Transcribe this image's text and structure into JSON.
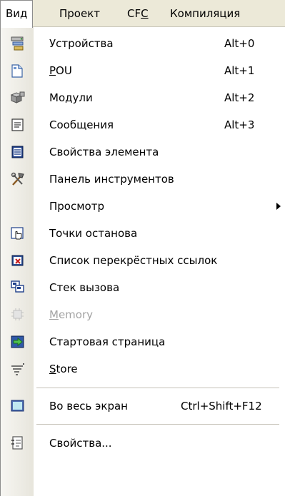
{
  "menubar": {
    "items": [
      {
        "label": "Вид"
      },
      {
        "label": "Проект"
      },
      {
        "label_prefix": "CF",
        "label_mnemonic": "C"
      },
      {
        "label": "Компиляция"
      }
    ]
  },
  "menu": {
    "items": [
      {
        "label": "Устройства",
        "shortcut": "Alt+0",
        "icon": "devices-icon"
      },
      {
        "label_mnemonic": "P",
        "label_rest": "OU",
        "shortcut": "Alt+1",
        "icon": "pou-icon"
      },
      {
        "label": "Модули",
        "shortcut": "Alt+2",
        "icon": "modules-icon"
      },
      {
        "label": "Сообщения",
        "shortcut": "Alt+3",
        "icon": "messages-icon"
      },
      {
        "label": "Свойства элемента",
        "icon": "element-properties-icon"
      },
      {
        "label": "Панель инструментов",
        "icon": "tools-icon"
      },
      {
        "label": "Просмотр",
        "submenu": true
      },
      {
        "label": "Точки останова",
        "icon": "breakpoints-icon"
      },
      {
        "label": "Список перекрёстных ссылок",
        "icon": "cross-references-icon"
      },
      {
        "label": "Стек вызова",
        "icon": "call-stack-icon"
      },
      {
        "label_mnemonic": "M",
        "label_rest": "emory",
        "disabled": true,
        "icon": "memory-icon"
      },
      {
        "label": "Стартовая страница",
        "icon": "start-page-icon"
      },
      {
        "label_mnemonic": "S",
        "label_rest": "tore",
        "icon": "store-icon"
      },
      {
        "label": "Во весь экран",
        "shortcut": "Ctrl+Shift+F12",
        "icon": "fullscreen-icon"
      },
      {
        "label": "Свойства...",
        "icon": "properties-icon"
      }
    ]
  },
  "colors": {
    "menubar_bg": "#ece9d8",
    "menu_bg": "#ffffff",
    "gutter": "#e7e5dc",
    "disabled_text": "#a3a3a3"
  }
}
